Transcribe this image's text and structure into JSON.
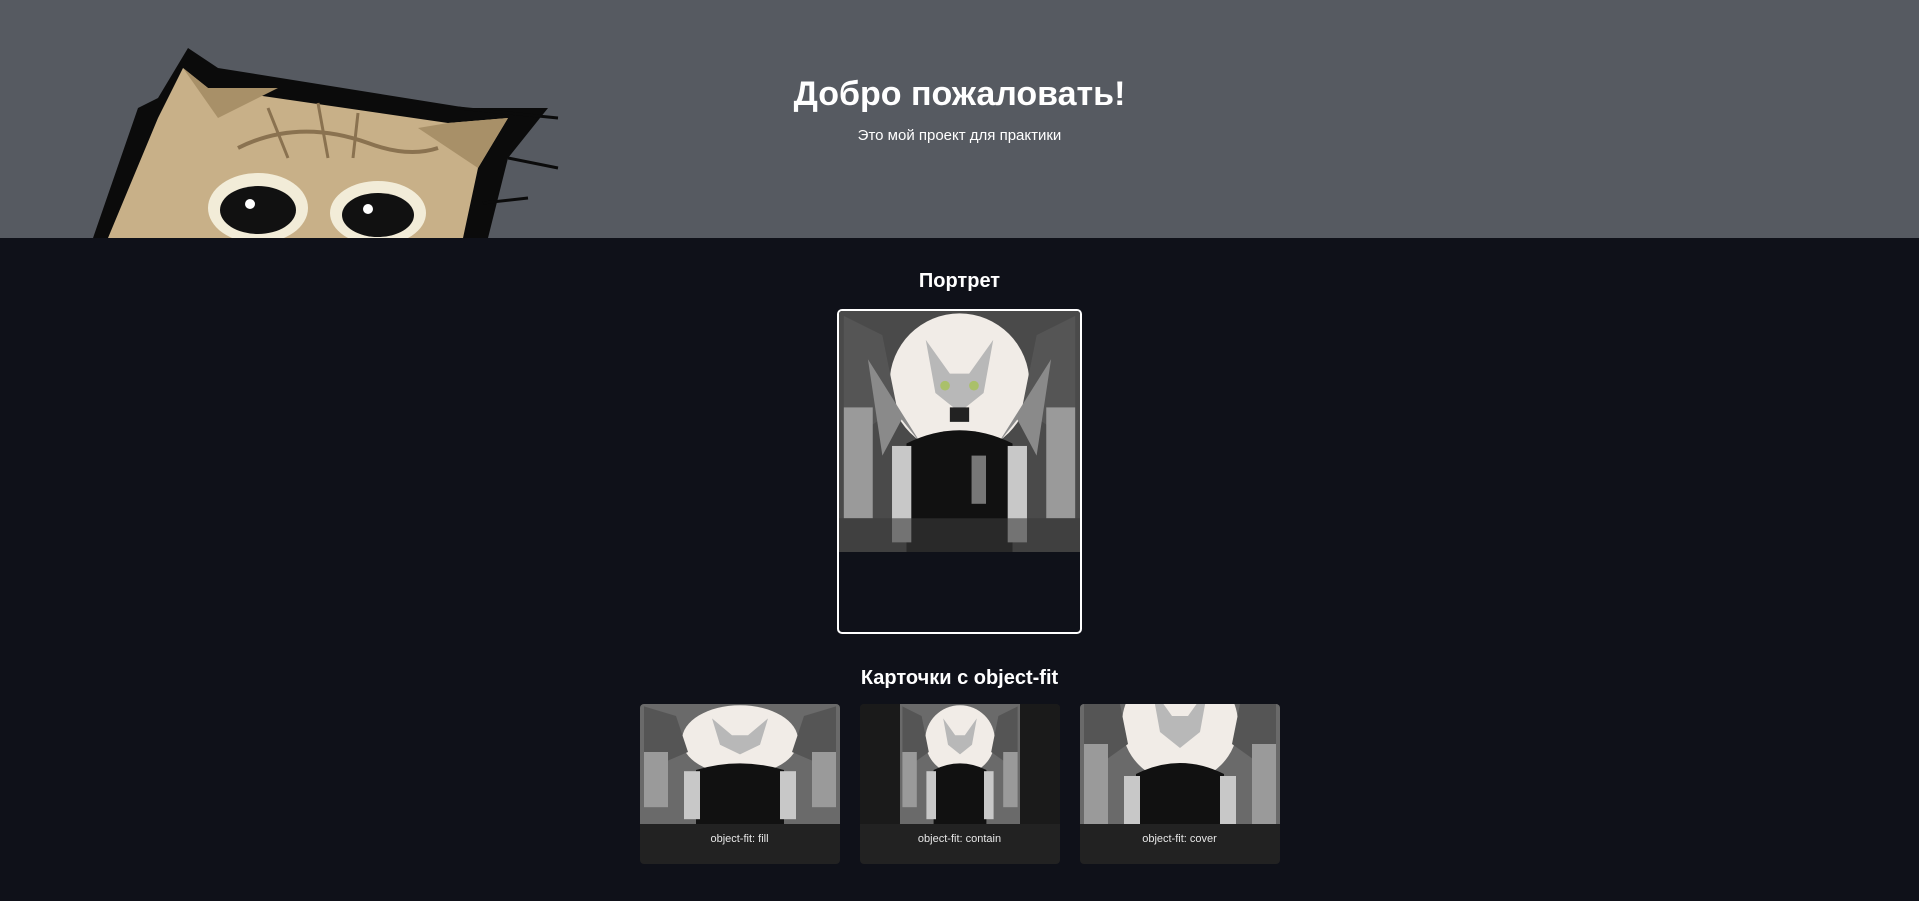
{
  "header": {
    "title": "Добро пожаловать!",
    "subtitle": "Это мой проект для практики"
  },
  "portrait": {
    "title": "Портрет"
  },
  "cards": {
    "title": "Карточки с object-fit",
    "items": [
      {
        "caption": "object-fit: fill"
      },
      {
        "caption": "object-fit: contain"
      },
      {
        "caption": "object-fit: cover"
      }
    ]
  }
}
